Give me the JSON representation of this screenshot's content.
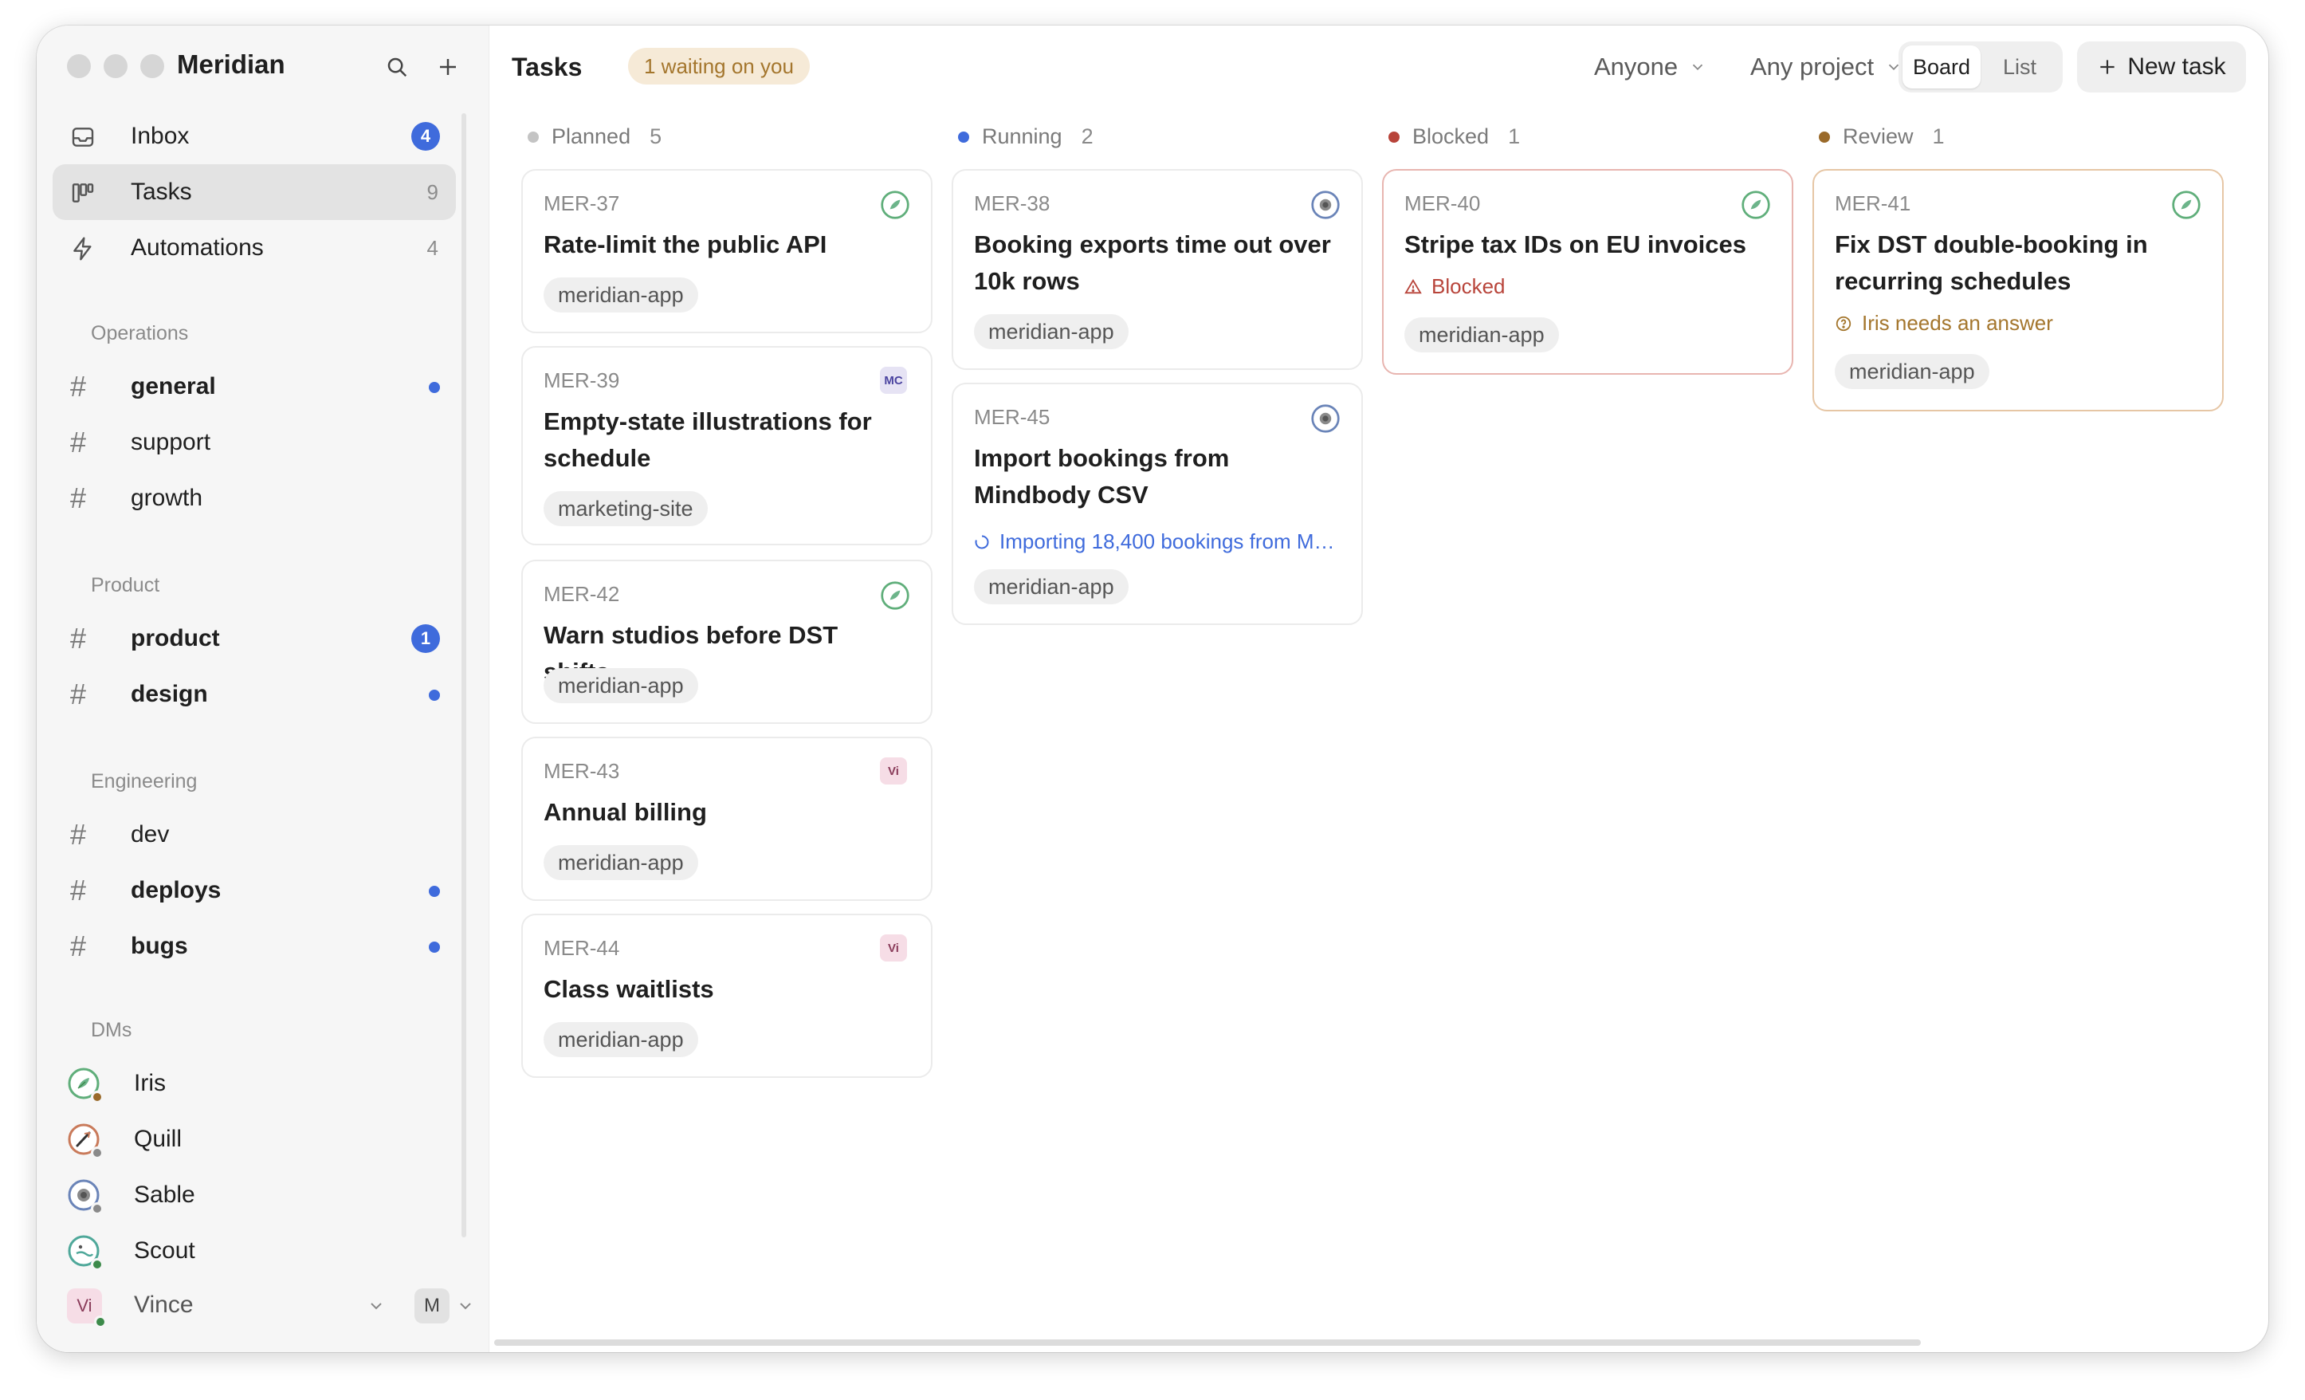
{
  "app": {
    "name": "Meridian"
  },
  "sidebar": {
    "nav": [
      {
        "label": "Inbox",
        "count": "4",
        "icon": "inbox-icon"
      },
      {
        "label": "Tasks",
        "count": "9",
        "icon": "board-icon"
      },
      {
        "label": "Automations",
        "count": "4",
        "icon": "lightning-icon"
      }
    ],
    "sections": [
      {
        "title": "Operations",
        "channels": [
          {
            "label": "general",
            "bold": true,
            "indicator": "dot"
          },
          {
            "label": "support",
            "bold": false,
            "indicator": ""
          },
          {
            "label": "growth",
            "bold": false,
            "indicator": ""
          }
        ]
      },
      {
        "title": "Product",
        "channels": [
          {
            "label": "product",
            "bold": true,
            "indicator": "1"
          },
          {
            "label": "design",
            "bold": true,
            "indicator": "dot"
          }
        ]
      },
      {
        "title": "Engineering",
        "channels": [
          {
            "label": "dev",
            "bold": false,
            "indicator": ""
          },
          {
            "label": "deploys",
            "bold": true,
            "indicator": "dot"
          },
          {
            "label": "bugs",
            "bold": true,
            "indicator": "dot"
          }
        ]
      }
    ],
    "dms_title": "DMs",
    "dms": [
      {
        "label": "Iris",
        "icon": "leaf-agent-icon",
        "presence": "#9a6a2a"
      },
      {
        "label": "Quill",
        "icon": "quill-agent-icon",
        "presence": "#8a8a8a"
      },
      {
        "label": "Sable",
        "icon": "sable-agent-icon",
        "presence": "#8a8a8a"
      },
      {
        "label": "Scout",
        "icon": "scout-agent-icon",
        "presence": "#3c8a4a"
      }
    ],
    "user": {
      "initials": "Vi",
      "name": "Vince",
      "workspace_initial": "M"
    }
  },
  "header": {
    "title": "Tasks",
    "waiting_badge": "1 waiting on you",
    "filter_assignee": "Anyone",
    "filter_project": "Any project",
    "view_board": "Board",
    "view_list": "List",
    "new_task": "New task"
  },
  "columns": [
    {
      "name": "Planned",
      "count": "5",
      "color": "#c4c4c4"
    },
    {
      "name": "Running",
      "count": "2",
      "color": "#3f6bdc"
    },
    {
      "name": "Blocked",
      "count": "1",
      "color": "#b8443a"
    },
    {
      "name": "Review",
      "count": "1",
      "color": "#9a6a2a"
    }
  ],
  "cards": {
    "planned": [
      {
        "id": "MER-37",
        "title": "Rate-limit the public API",
        "tag": "meridian-app",
        "assignee": "leaf-agent-icon"
      },
      {
        "id": "MER-39",
        "title": "Empty-state illustrations for schedule",
        "tag": "marketing-site",
        "assignee": "MC"
      },
      {
        "id": "MER-42",
        "title": "Warn studios before DST shifts",
        "tag": "meridian-app",
        "assignee": "leaf-agent-icon"
      },
      {
        "id": "MER-43",
        "title": "Annual billing",
        "tag": "meridian-app",
        "assignee": "Vi"
      },
      {
        "id": "MER-44",
        "title": "Class waitlists",
        "tag": "meridian-app",
        "assignee": "Vi"
      }
    ],
    "running": [
      {
        "id": "MER-38",
        "title": "Booking exports time out over 10k rows",
        "tag": "meridian-app",
        "assignee": "sable-agent-icon"
      },
      {
        "id": "MER-45",
        "title": "Import bookings from Mindbody CSV",
        "tag": "meridian-app",
        "assignee": "sable-agent-icon",
        "status": "Importing 18,400 bookings from M…"
      }
    ],
    "blocked": [
      {
        "id": "MER-40",
        "title": "Stripe tax IDs on EU invoices",
        "tag": "meridian-app",
        "assignee": "leaf-agent-icon",
        "status": "Blocked"
      }
    ],
    "review": [
      {
        "id": "MER-41",
        "title": "Fix DST double-booking in recurring schedules",
        "tag": "meridian-app",
        "assignee": "leaf-agent-icon",
        "status": "Iris needs an answer"
      }
    ]
  },
  "colors": {
    "accent": "#3f6bdc",
    "blocked": "#b8443a",
    "review": "#a4762d",
    "running_status": "#3f6bdc"
  }
}
